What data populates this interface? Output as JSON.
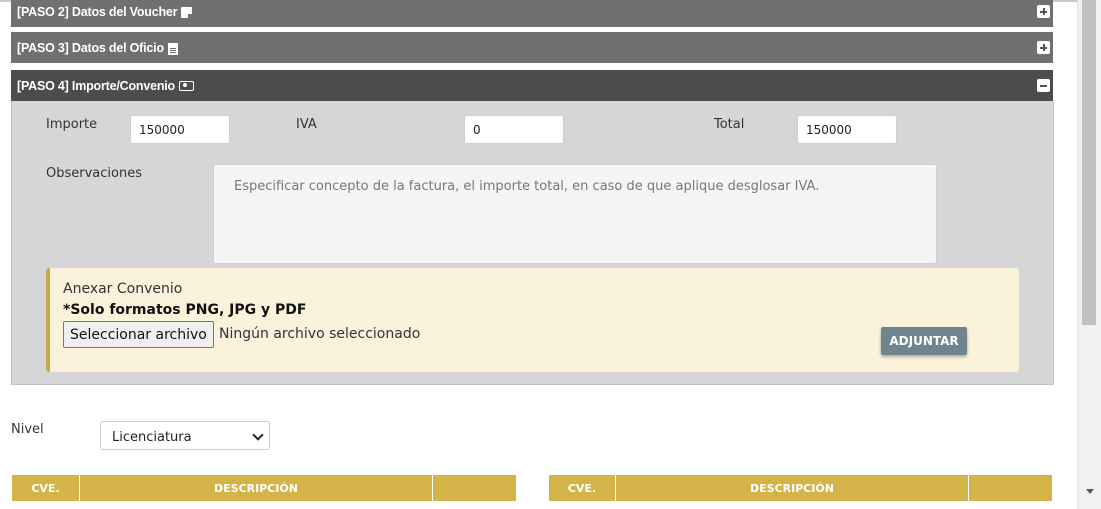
{
  "panels": {
    "paso2": {
      "title": "[PASO 2] Datos del Voucher",
      "icon": "note-icon",
      "state": "collapsed"
    },
    "paso3": {
      "title": "[PASO 3] Datos del Oficio",
      "icon": "file-text-icon",
      "state": "collapsed"
    },
    "paso4": {
      "title": "[PASO 4] Importe/Convenio",
      "icon": "money-icon",
      "state": "expanded"
    }
  },
  "form": {
    "importe_label": "Importe",
    "importe_value": "150000",
    "iva_label": "IVA",
    "iva_value": "0",
    "total_label": "Total",
    "total_value": "150000",
    "observaciones_label": "Observaciones",
    "observaciones_placeholder": "Especificar concepto de la factura, el importe total, en caso de que aplique desglosar IVA."
  },
  "attach": {
    "title": "Anexar Convenio",
    "note": "*Solo formatos PNG, JPG y PDF",
    "file_button": "Seleccionar archivo",
    "file_status": "Ningún archivo seleccionado",
    "submit": "ADJUNTAR"
  },
  "nivel": {
    "label": "Nivel",
    "selected": "Licenciatura"
  },
  "tables": {
    "left": {
      "col_cve": "CVE.",
      "col_desc": "DESCRIPCIÓN"
    },
    "right": {
      "col_cve": "CVE.",
      "col_desc": "DESCRIPCIÓN"
    }
  },
  "colors": {
    "header_collapsed": "#707070",
    "header_expanded": "#4c4c4c",
    "panel_body": "#d6d6d8",
    "attach_bg": "#fbf2dc",
    "attach_accent": "#c9a94a",
    "table_header": "#d4b349",
    "button_adjuntar": "#6e8590"
  }
}
